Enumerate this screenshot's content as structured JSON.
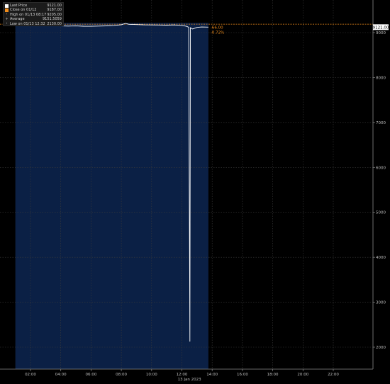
{
  "legend": [
    {
      "label": "Last Price",
      "value": "9121.00",
      "marker": "white-box"
    },
    {
      "label": "Close on 01/12",
      "value": "9187.00",
      "marker": "orange-box"
    },
    {
      "label": "High on 01/13 08:17",
      "value": "9205.00",
      "marker": "up-tick"
    },
    {
      "label": "Average",
      "value": "9151.5059",
      "marker": "plus"
    },
    {
      "label": "Low on 01/13 12:32",
      "value": "2130.00",
      "marker": "down-tick"
    }
  ],
  "last_price_tag": "9121.00",
  "change_abs": "-66.00",
  "change_pct": "-0.72%",
  "date_label": "13 Jan 2023",
  "colors": {
    "background": "#000000",
    "session_shade": "#0b2045",
    "price_line": "#ffffff",
    "close_line": "#f08c1a",
    "grid": "#3a3a3a",
    "axis_text": "#bdbdbd"
  },
  "chart_data": {
    "type": "line",
    "ylim": [
      1500,
      9300
    ],
    "y_ticks": [
      2000,
      3000,
      4000,
      5000,
      6000,
      7000,
      8000,
      9000
    ],
    "y_tick_labels": [
      "2000",
      "3000",
      "4000",
      "5000",
      "6000",
      "7000",
      "8000",
      "9000"
    ],
    "x_range_hours": [
      0.5,
      24.5
    ],
    "x_ticks": [
      2,
      4,
      6,
      8,
      10,
      12,
      14,
      16,
      18,
      20,
      22
    ],
    "x_tick_labels": [
      "02:00",
      "04:00",
      "06:00",
      "08:00",
      "10:00",
      "12:00",
      "14:00",
      "16:00",
      "18:00",
      "20:00",
      "22:00"
    ],
    "session_hours": [
      1.0,
      13.75
    ],
    "close_value": 9187,
    "grid": true,
    "series": [
      {
        "x_hours": [
          1.0,
          1.5,
          2.0,
          2.5,
          3.0,
          3.5,
          4.0,
          4.5,
          5.0,
          5.5,
          6.0,
          6.5,
          7.0,
          7.5,
          8.0,
          8.28,
          8.5,
          9.0,
          9.5,
          10.0,
          10.5,
          11.0,
          11.5,
          12.0,
          12.3,
          12.45,
          12.53,
          12.56,
          12.7,
          13.0,
          13.3,
          13.75
        ],
        "values": [
          9170,
          9165,
          9160,
          9158,
          9162,
          9155,
          9150,
          9145,
          9148,
          9142,
          9140,
          9145,
          9150,
          9160,
          9175,
          9205,
          9185,
          9178,
          9172,
          9170,
          9168,
          9166,
          9170,
          9160,
          9140,
          9120,
          2130,
          9110,
          9080,
          9115,
          9125,
          9121
        ]
      }
    ]
  }
}
